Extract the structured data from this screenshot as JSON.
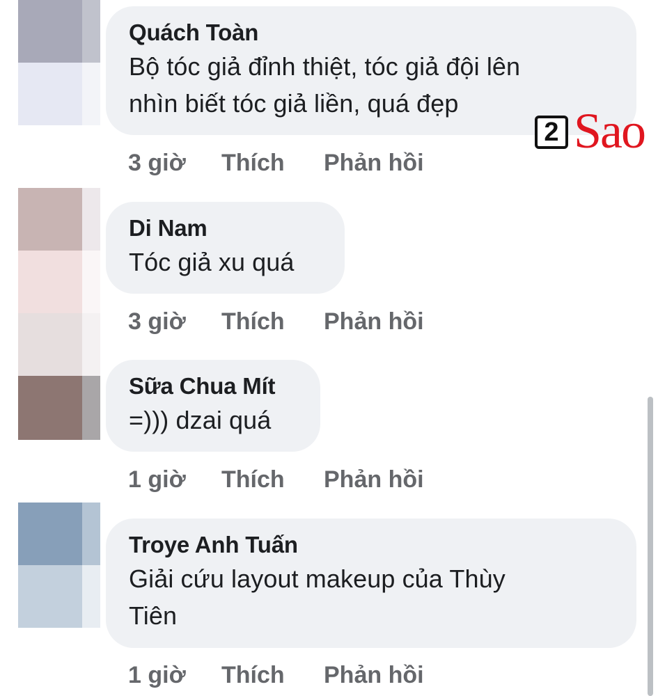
{
  "comments": [
    {
      "author": "Quách Toàn",
      "text_lines": [
        "Bộ tóc giả đỉnh thiệt, tóc giả đội lên",
        "nhìn biết tóc giả liền, quá đẹp"
      ],
      "time": "3 giờ",
      "like_label": "Thích",
      "reply_label": "Phản hồi"
    },
    {
      "author": "Di Nam",
      "text_lines": [
        "Tóc giả xu quá"
      ],
      "time": "3 giờ",
      "like_label": "Thích",
      "reply_label": "Phản hồi"
    },
    {
      "author": "Sữa Chua Mít",
      "text_lines": [
        "=))) dzai quá"
      ],
      "time": "1 giờ",
      "like_label": "Thích",
      "reply_label": "Phản hồi"
    },
    {
      "author": "Troye Anh Tuấn",
      "text_lines": [
        "Giải cứu layout makeup của Thùy",
        "Tiên"
      ],
      "time": "1 giờ",
      "like_label": "Thích",
      "reply_label": "Phản hồi"
    }
  ],
  "watermark": {
    "number": "2",
    "word": "Sao"
  },
  "colors": {
    "bubble": "#eff1f4",
    "text": "#1c1e21",
    "meta": "#65676b",
    "watermark_red": "#e0161f"
  }
}
